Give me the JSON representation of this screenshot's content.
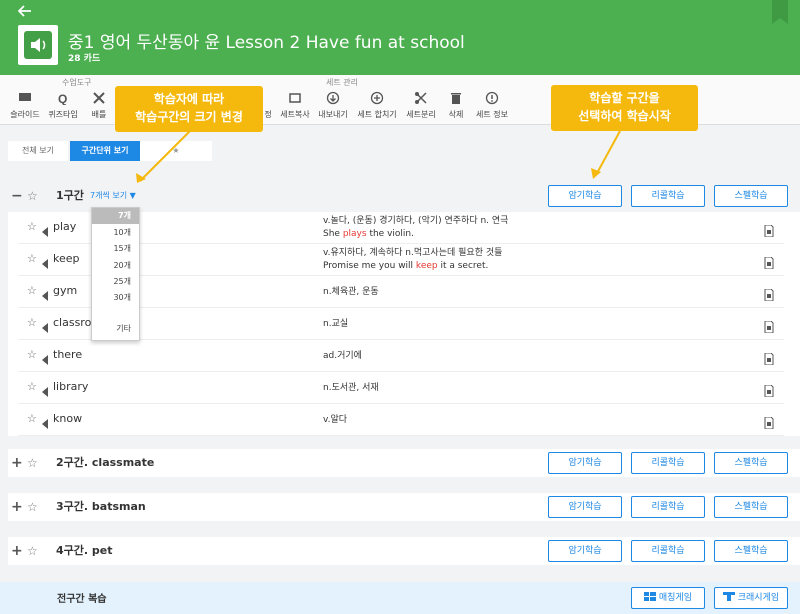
{
  "header": {
    "back_icon": "arrow-left-icon",
    "title": "중1 영어 두산동아 윤 Lesson 2 Have fun at school",
    "count": "28 카드"
  },
  "toolbar": {
    "group1_label": "수업도구",
    "group2_label": "세트 관리",
    "tools1": [
      {
        "label": "슬라이드",
        "icon": "slide-icon"
      },
      {
        "label": "퀴즈타임",
        "icon": "quiz-icon"
      },
      {
        "label": "배틀",
        "icon": "battle-icon"
      }
    ],
    "tools2_partial": "정",
    "tools2": [
      {
        "label": "세트복사",
        "icon": "copy-icon"
      },
      {
        "label": "내보내기",
        "icon": "export-icon"
      },
      {
        "label": "세트 합치기",
        "icon": "merge-icon"
      },
      {
        "label": "세트분리",
        "icon": "split-icon"
      },
      {
        "label": "삭제",
        "icon": "trash-icon"
      },
      {
        "label": "세트 정보",
        "icon": "info-icon"
      }
    ]
  },
  "callouts": {
    "left_line1": "학습자에 따라",
    "left_line2": "학습구간의 크기 변경",
    "right_line1": "학습할 구간을",
    "right_line2": "선택하여 학습시작"
  },
  "view_tabs": {
    "all": "전체 보기",
    "section": "구간단위 보기",
    "star": "★"
  },
  "buttons": {
    "memorize": "암기학습",
    "recall": "리콜학습",
    "spell": "스펠학습"
  },
  "section1": {
    "sign": "−",
    "title": "1구간",
    "perpage": "7개씩 보기 ▼",
    "rows": [
      {
        "word": "play",
        "def1": "v.놀다, (운동) 경기하다, (악기) 연주하다 n. 연극",
        "def2_pre": "She ",
        "def2_hl": "plays",
        "def2_post": " the violin."
      },
      {
        "word": "keep",
        "def1": "v.유지하다, 계속하다 n.먹고사는데 필요한 것들",
        "def2_pre": "Promise me you will ",
        "def2_hl": "keep",
        "def2_post": " it a secret."
      },
      {
        "word": "gym",
        "def1": "n.체육관, 운동"
      },
      {
        "word": "classro",
        "def1": "n.교실"
      },
      {
        "word": "there",
        "def1": "ad.거기에"
      },
      {
        "word": "library",
        "def1": "n.도서관, 서재"
      },
      {
        "word": "know",
        "def1": "v.알다"
      }
    ]
  },
  "dropdown": [
    "7개",
    "10개",
    "15개",
    "20개",
    "25개",
    "30개",
    "기타"
  ],
  "sections": [
    {
      "sign": "+",
      "title": "2구간. classmate"
    },
    {
      "sign": "+",
      "title": "3구간. batsman"
    },
    {
      "sign": "+",
      "title": "4구간. pet"
    }
  ],
  "footer": {
    "title": "전구간 복습",
    "matching": "매칭게임",
    "crash": "크래시게임"
  },
  "colors": {
    "header": "#4caf50",
    "accent": "#1e88e5",
    "callout": "#f5b90e",
    "highlight": "#e53935"
  }
}
